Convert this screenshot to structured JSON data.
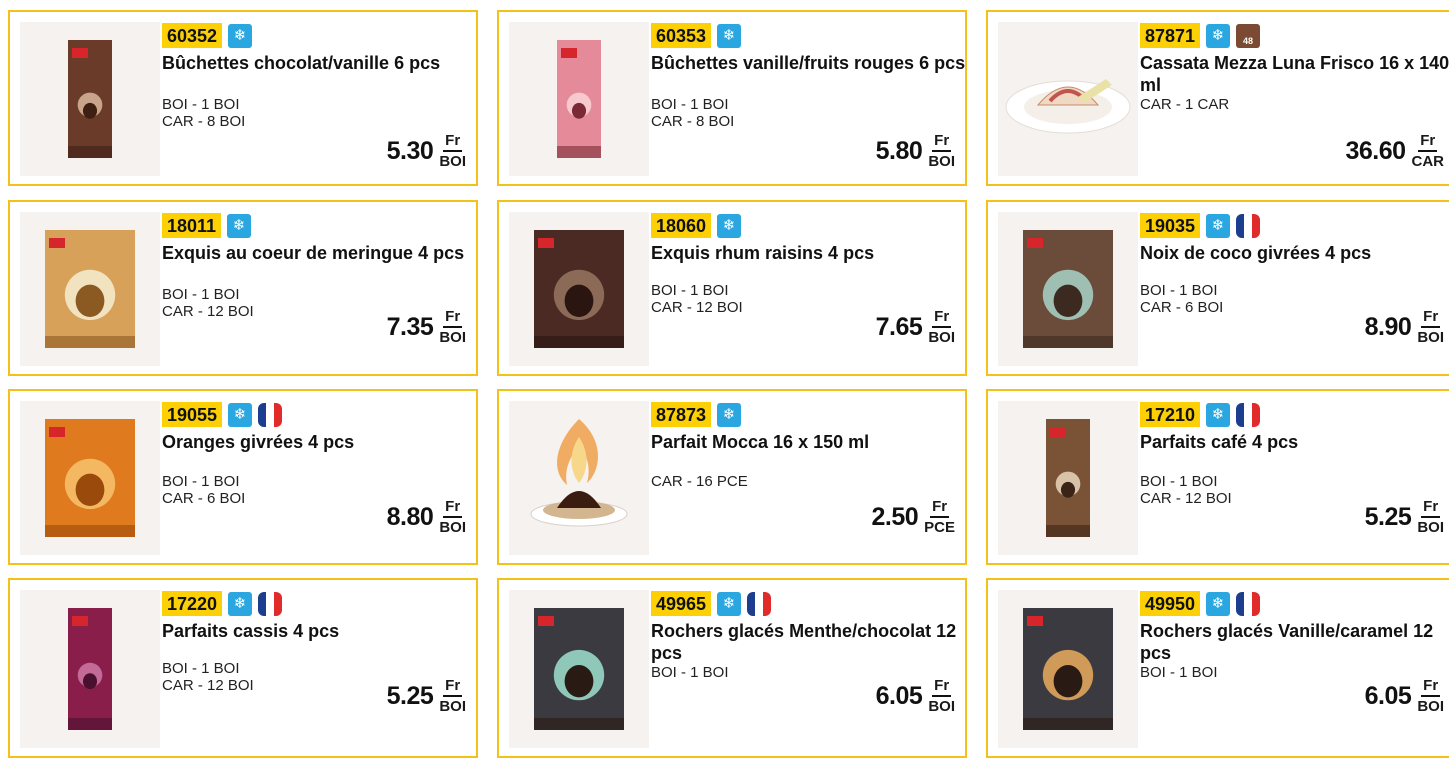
{
  "colors": {
    "border": "#f2c21a",
    "code_bg": "#fcd005",
    "frozen": "#2aa7e0",
    "flag_blue": "#1d3e8f",
    "flag_red": "#e12a2a"
  },
  "products": [
    {
      "code": "60352",
      "badges": [
        "snowflake-icon"
      ],
      "name": "Bûchettes chocolat/vanille 6 pcs",
      "units": [
        "BOI - 1 BOI",
        "CAR - 8 BOI"
      ],
      "price": "5.30",
      "currency": "Fr",
      "unit": "BOI",
      "image": "chocolate-vanilla-ice-box"
    },
    {
      "code": "60353",
      "badges": [
        "snowflake-icon"
      ],
      "name": "Bûchettes vanille/fruits rouges 6 pcs",
      "units": [
        "BOI - 1 BOI",
        "CAR - 8 BOI"
      ],
      "price": "5.80",
      "currency": "Fr",
      "unit": "BOI",
      "image": "red-fruit-ice-box"
    },
    {
      "code": "87871",
      "badges": [
        "snowflake-icon",
        "48h-icon"
      ],
      "name": "Cassata Mezza Luna Frisco 16 x 140 ml",
      "units": [
        "CAR - 1 CAR"
      ],
      "price": "36.60",
      "currency": "Fr",
      "unit": "CAR",
      "image": "cassata-plate"
    },
    {
      "code": "18011",
      "badges": [
        "snowflake-icon"
      ],
      "name": "Exquis au coeur de meringue 4 pcs",
      "units": [
        "BOI - 1 BOI",
        "CAR - 12 BOI"
      ],
      "price": "7.35",
      "currency": "Fr",
      "unit": "BOI",
      "image": "meringue-ice-box"
    },
    {
      "code": "18060",
      "badges": [
        "snowflake-icon"
      ],
      "name": "Exquis rhum raisins 4 pcs",
      "units": [
        "BOI - 1 BOI",
        "CAR - 12 BOI"
      ],
      "price": "7.65",
      "currency": "Fr",
      "unit": "BOI",
      "image": "rum-raisin-ice-box"
    },
    {
      "code": "19035",
      "badges": [
        "snowflake-icon",
        "flag-fr-icon"
      ],
      "name": "Noix de coco givrées 4 pcs",
      "units": [
        "BOI - 1 BOI",
        "CAR - 6 BOI"
      ],
      "price": "8.90",
      "currency": "Fr",
      "unit": "BOI",
      "image": "coconut-ice-box"
    },
    {
      "code": "19055",
      "badges": [
        "snowflake-icon",
        "flag-fr-icon"
      ],
      "name": "Oranges givrées 4 pcs",
      "units": [
        "BOI - 1 BOI",
        "CAR - 6 BOI"
      ],
      "price": "8.80",
      "currency": "Fr",
      "unit": "BOI",
      "image": "orange-ice-box"
    },
    {
      "code": "87873",
      "badges": [
        "snowflake-icon"
      ],
      "name": "Parfait Mocca 16 x 150 ml",
      "units": [
        "CAR - 16 PCE"
      ],
      "price": "2.50",
      "currency": "Fr",
      "unit": "PCE",
      "image": "flambe-parfait"
    },
    {
      "code": "17210",
      "badges": [
        "snowflake-icon",
        "flag-fr-icon"
      ],
      "name": "Parfaits café 4 pcs",
      "units": [
        "BOI - 1 BOI",
        "CAR - 12 BOI"
      ],
      "price": "5.25",
      "currency": "Fr",
      "unit": "BOI",
      "image": "coffee-parfait-box"
    },
    {
      "code": "17220",
      "badges": [
        "snowflake-icon",
        "flag-fr-icon"
      ],
      "name": "Parfaits cassis 4 pcs",
      "units": [
        "BOI - 1 BOI",
        "CAR - 12 BOI"
      ],
      "price": "5.25",
      "currency": "Fr",
      "unit": "BOI",
      "image": "cassis-parfait-box"
    },
    {
      "code": "49965",
      "badges": [
        "snowflake-icon",
        "flag-fr-icon"
      ],
      "name": "Rochers glacés Menthe/chocolat 12 pcs",
      "units": [
        "BOI - 1 BOI"
      ],
      "price": "6.05",
      "currency": "Fr",
      "unit": "BOI",
      "image": "mint-rocher-box"
    },
    {
      "code": "49950",
      "badges": [
        "snowflake-icon",
        "flag-fr-icon"
      ],
      "name": "Rochers glacés Vanille/caramel 12 pcs",
      "units": [
        "BOI - 1 BOI"
      ],
      "price": "6.05",
      "currency": "Fr",
      "unit": "BOI",
      "image": "caramel-rocher-box"
    }
  ]
}
